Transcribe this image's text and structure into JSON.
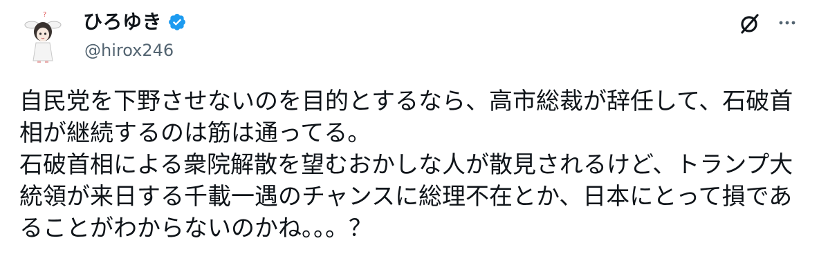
{
  "author": {
    "display_name": "ひろゆき",
    "handle": "@hirox246",
    "avatar_icon": "avatar-illustration-icon",
    "verified_icon": "verified-badge-icon",
    "verified_color": "#1d9bf0"
  },
  "actions": {
    "grok_icon": "grok-icon",
    "more_icon": "more-dots-icon"
  },
  "post": {
    "text": "自民党を下野させないのを目的とするなら、高市総裁が辞任して、石破首相が継続するのは筋は通ってる。\n石破首相による衆院解散を望むおかしな人が散見されるけど、トランプ大統領が来日する千載一遇のチャンスに総理不在とか、日本にとって損であることがわからないのかね。。。？"
  },
  "colors": {
    "text": "#0f1419",
    "secondary": "#536471",
    "background": "#ffffff"
  }
}
